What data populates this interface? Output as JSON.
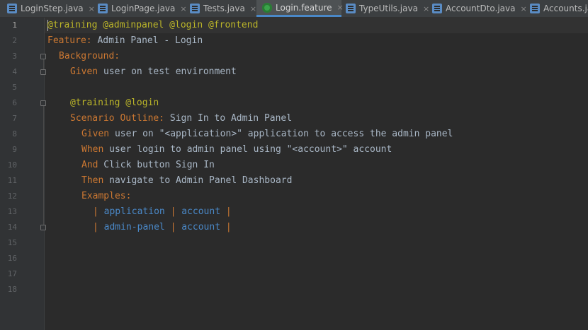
{
  "tabs": [
    {
      "label": "LoginStep.java",
      "icon": "java-class-icon",
      "active": false
    },
    {
      "label": "LoginPage.java",
      "icon": "java-class-icon",
      "active": false
    },
    {
      "label": "Tests.java",
      "icon": "java-class-icon",
      "active": false
    },
    {
      "label": "Login.feature",
      "icon": "cucumber-feature-icon",
      "active": true
    },
    {
      "label": "TypeUtils.java",
      "icon": "java-class-icon",
      "active": false
    },
    {
      "label": "AccountDto.java",
      "icon": "java-class-icon",
      "active": false
    },
    {
      "label": "Accounts.ja",
      "icon": "java-class-icon",
      "active": false
    }
  ],
  "close_glyph": "×",
  "line_numbers": [
    "1",
    "2",
    "3",
    "4",
    "5",
    "6",
    "7",
    "8",
    "9",
    "10",
    "11",
    "12",
    "13",
    "14",
    "15",
    "16",
    "17",
    "18"
  ],
  "code": {
    "l1": {
      "tags": "@training @adminpanel @login @frontend"
    },
    "l2": {
      "kw": "Feature:",
      "text": " Admin Panel - Login"
    },
    "l3": {
      "kw": "Background:"
    },
    "l4": {
      "kw": "Given",
      "text": " user on test environment"
    },
    "l6": {
      "tags": "@training @login"
    },
    "l7": {
      "kw": "Scenario Outline:",
      "text": " Sign In to Admin Panel"
    },
    "l8": {
      "kw": "Given",
      "text": " user on \"<application>\" application to access the admin panel"
    },
    "l9": {
      "kw": "When",
      "text": " user login to admin panel using \"<account>\" account"
    },
    "l10": {
      "kw": "And",
      "text": " Click button Sign In"
    },
    "l11": {
      "kw": "Then",
      "text": " navigate to Admin Panel Dashboard"
    },
    "l12": {
      "kw": "Examples:"
    },
    "l13": {
      "pipe": "|",
      "c1": "application",
      "c2": "account"
    },
    "l14": {
      "pipe": "|",
      "c1": "admin-panel",
      "c2": "account"
    }
  },
  "colors": {
    "keyword": "#cc7832",
    "tag": "#bbb529",
    "text": "#a9b7c6",
    "table_cell": "#4a88c7",
    "accent": "#4a88c7"
  }
}
